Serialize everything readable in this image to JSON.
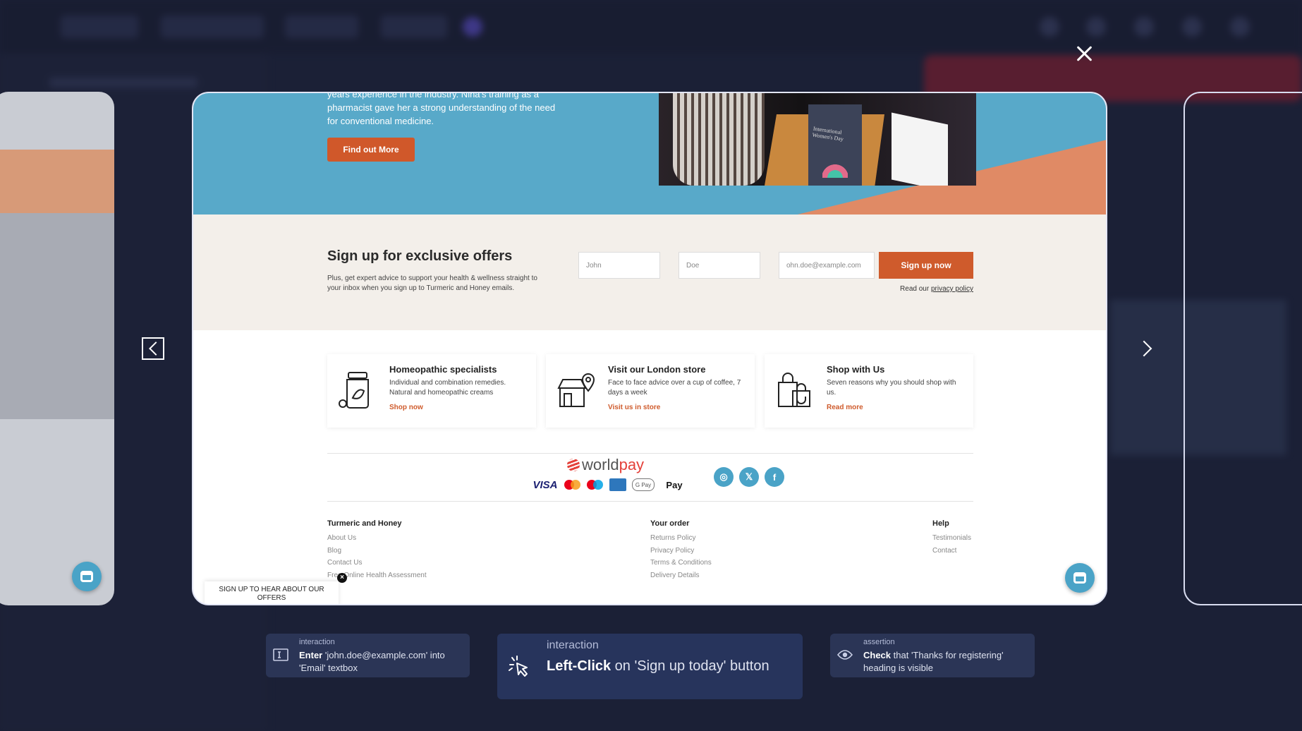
{
  "hero": {
    "text": "years experience in the industry. Nina's training as a pharmacist gave her a strong understanding of the need for conventional medicine.",
    "button_label": "Find out More",
    "photo_banner_text": "International Women's Day"
  },
  "signup": {
    "title": "Sign up for exclusive offers",
    "subtitle": "Plus, get expert advice to support your health & wellness straight to your inbox when you sign up to Turmeric and Honey emails.",
    "first_name_value": "John",
    "last_name_value": "Doe",
    "email_value": "ohn.doe@example.com",
    "button_label": "Sign up now",
    "privacy_prefix": "Read our",
    "privacy_link": "privacy policy"
  },
  "features": [
    {
      "icon": "jar-leaf-icon",
      "title": "Homeopathic specialists",
      "desc": "Individual and combination remedies. Natural and homeopathic creams",
      "link": "Shop now"
    },
    {
      "icon": "store-location-icon",
      "title": "Visit our London store",
      "desc": "Face to face advice over a cup of coffee, 7 days a week",
      "link": "Visit us in store"
    },
    {
      "icon": "shopping-bag-icon",
      "title": "Shop with Us",
      "desc": "Seven reasons why you should shop with us.",
      "link": "Read more"
    }
  ],
  "payments": {
    "provider_a": "world",
    "provider_b": "pay",
    "methods": [
      "VISA",
      "",
      "",
      "",
      "G Pay",
      " Pay"
    ]
  },
  "socials": [
    {
      "icon": "instagram-icon",
      "glyph": "◎"
    },
    {
      "icon": "x-twitter-icon",
      "glyph": "𝕏"
    },
    {
      "icon": "facebook-icon",
      "glyph": "f"
    }
  ],
  "footer": {
    "col1": {
      "heading": "Turmeric and Honey",
      "links": [
        "About Us",
        "Blog",
        "Contact Us",
        "Free Online Health Assessment"
      ]
    },
    "col2": {
      "heading": "Your order",
      "links": [
        "Returns Policy",
        "Privacy Policy",
        "Terms & Conditions",
        "Delivery Details"
      ]
    },
    "col3": {
      "heading": "Help",
      "links": [
        "Testimonials",
        "Contact"
      ]
    }
  },
  "offers_tab": {
    "text": "SIGN UP TO HEAR ABOUT OUR OFFERS",
    "close": "×"
  },
  "steps": [
    {
      "kind": "interaction",
      "verb": "Enter",
      "rest": " 'john.doe@example.com' into 'Email' textbox",
      "icon": "textbox-icon"
    },
    {
      "kind": "interaction",
      "verb": "Left-Click",
      "rest": " on 'Sign up today' button",
      "icon": "cursor-click-icon"
    },
    {
      "kind": "assertion",
      "verb": "Check",
      "rest": " that 'Thanks for registering' heading is visible",
      "icon": "eye-icon"
    }
  ],
  "colors": {
    "background": "#1b2036",
    "hero_blue": "#58a9c9",
    "accent_orange": "#cf5b2c",
    "signup_bg": "#f3efea",
    "step_chip": "#2b3556"
  }
}
